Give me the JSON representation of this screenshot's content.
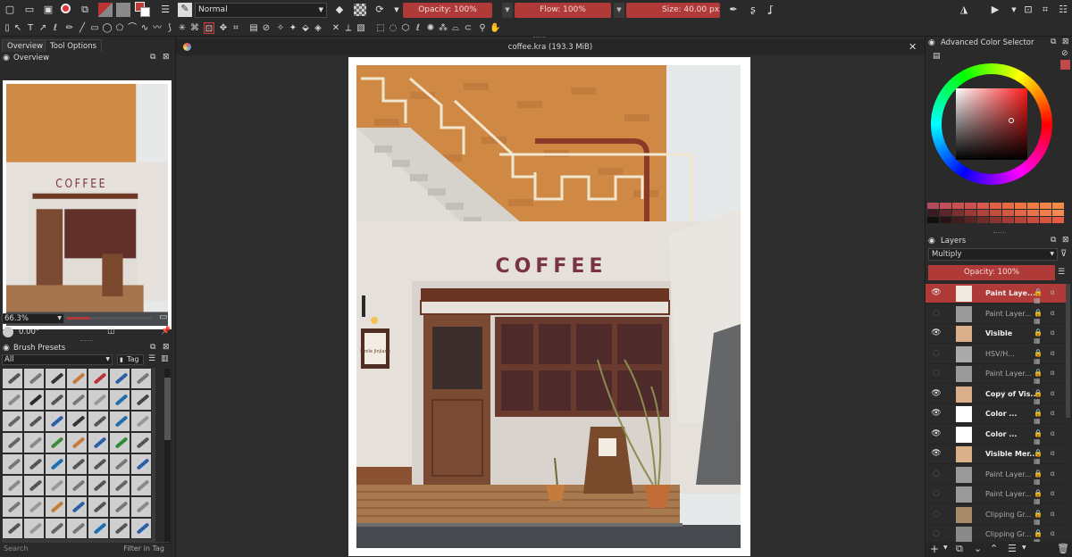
{
  "app": {
    "document_title": "coffee.kra (193.3 MiB)"
  },
  "toolbar": {
    "blend_mode": "Normal",
    "opacity_label": "Opacity: 100%",
    "flow_label": "Flow: 100%",
    "size_label": "Size: 40.00 px"
  },
  "left_panel": {
    "tabs": [
      "Overview",
      "Tool Options"
    ],
    "overview_title": "Overview",
    "zoom_value": "66.3%",
    "rotation_value": "0.00°",
    "brush_presets_title": "Brush Presets",
    "brush_filter_value": "All",
    "tag_label": "Tag",
    "search_placeholder": "Search",
    "filter_in_tag_label": "Filter in Tag"
  },
  "canvas": {
    "art_sign_text": "COFFEE",
    "art_sign_color": "#7a3344",
    "art_small_sign_text": "Smile Jinjiang"
  },
  "color_selector": {
    "title": "Advanced Color Selector",
    "current_color": "#c04a4a",
    "swatches_row1": [
      "#b04a5c",
      "#c44e5a",
      "#c85050",
      "#d05050",
      "#d85a4e",
      "#e06048",
      "#e86a44",
      "#ee7442",
      "#f07c44",
      "#f28446",
      "#f48c48"
    ],
    "swatches_row2": [
      "#3a1c20",
      "#5a2628",
      "#7a3030",
      "#9a3a36",
      "#b0443a",
      "#c24e3e",
      "#d25a42",
      "#e06646",
      "#e8724a",
      "#f07e4e",
      "#f48a52"
    ],
    "swatches_row3": [
      "#101010",
      "#281414",
      "#401c1c",
      "#582424",
      "#702c2a",
      "#883430",
      "#a03c34",
      "#b64438",
      "#c84c3c",
      "#d85440",
      "#e45c44"
    ]
  },
  "layers": {
    "title": "Layers",
    "blend_mode": "Multiply",
    "opacity_label": "Opacity:  100%",
    "items": [
      {
        "name": "Paint Laye...",
        "selected": true,
        "visible": true
      },
      {
        "name": "Paint Layer...",
        "selected": false,
        "visible": false
      },
      {
        "name": "Visible",
        "selected": false,
        "visible": true
      },
      {
        "name": "HSV/H...",
        "selected": false,
        "visible": false
      },
      {
        "name": "Paint Layer...",
        "selected": false,
        "visible": false
      },
      {
        "name": "Copy of Vis...",
        "selected": false,
        "visible": true
      },
      {
        "name": "Color ...",
        "selected": false,
        "visible": true
      },
      {
        "name": "Color ...",
        "selected": false,
        "visible": true
      },
      {
        "name": "Visible Mer...",
        "selected": false,
        "visible": true
      },
      {
        "name": "Paint Layer...",
        "selected": false,
        "visible": false
      },
      {
        "name": "Paint Layer...",
        "selected": false,
        "visible": false
      },
      {
        "name": "Clipping Gr...",
        "selected": false,
        "visible": false
      },
      {
        "name": "Clipping Gr...",
        "selected": false,
        "visible": false
      }
    ],
    "flags_text": "🔒 α ▦"
  },
  "icons": {
    "new": "new-document-icon",
    "open": "open-folder-icon",
    "save": "save-icon",
    "record": "record-icon",
    "close": "close-icon",
    "eye": "eye-icon"
  }
}
